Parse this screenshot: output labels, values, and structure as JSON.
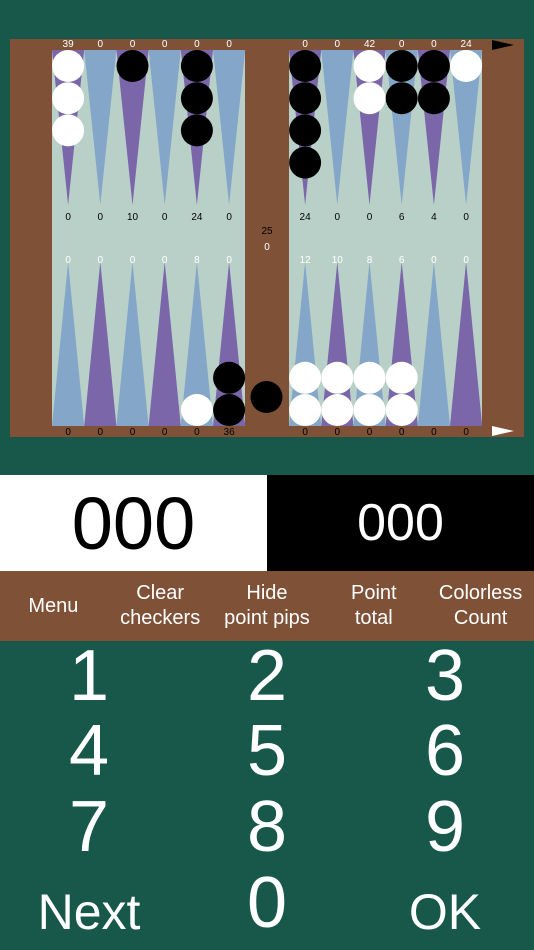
{
  "colors": {
    "background": "#17584a",
    "board_frame": "#7f5238",
    "board_field": "#b9d0c8",
    "point_blue": "#84a6c8",
    "point_purple": "#7a66a8",
    "checker_white": "#ffffff",
    "checker_black": "#000000"
  },
  "board": {
    "top_counts_left": [
      "39",
      "0",
      "0",
      "0",
      "0",
      "0"
    ],
    "top_counts_right": [
      "0",
      "0",
      "42",
      "0",
      "0",
      "24"
    ],
    "top_pips_left": [
      "0",
      "0",
      "10",
      "0",
      "24",
      "0"
    ],
    "top_pips_right": [
      "24",
      "0",
      "0",
      "6",
      "4",
      "0"
    ],
    "bottom_pips_left": [
      "0",
      "0",
      "0",
      "0",
      "8",
      "0"
    ],
    "bottom_pips_right": [
      "12",
      "10",
      "8",
      "6",
      "0",
      "0"
    ],
    "bottom_counts_left": [
      "0",
      "0",
      "0",
      "0",
      "0",
      "36"
    ],
    "bottom_counts_right": [
      "0",
      "0",
      "0",
      "0",
      "0",
      "0"
    ],
    "bar_top_value": "25",
    "bar_bottom_value": "0",
    "top_checkers_left": [
      {
        "color": "white",
        "count": 3
      },
      {
        "color": "none",
        "count": 0
      },
      {
        "color": "black",
        "count": 1
      },
      {
        "color": "none",
        "count": 0
      },
      {
        "color": "black",
        "count": 3
      },
      {
        "color": "none",
        "count": 0
      }
    ],
    "top_checkers_right": [
      {
        "color": "black",
        "count": 4
      },
      {
        "color": "none",
        "count": 0
      },
      {
        "color": "white",
        "count": 2
      },
      {
        "color": "black",
        "count": 2
      },
      {
        "color": "black",
        "count": 2
      },
      {
        "color": "white",
        "count": 1
      }
    ],
    "bottom_checkers_left": [
      {
        "color": "none",
        "count": 0
      },
      {
        "color": "none",
        "count": 0
      },
      {
        "color": "none",
        "count": 0
      },
      {
        "color": "none",
        "count": 0
      },
      {
        "color": "white",
        "count": 1
      },
      {
        "color": "black",
        "count": 2
      }
    ],
    "bottom_checkers_right": [
      {
        "color": "white",
        "count": 2
      },
      {
        "color": "white",
        "count": 2
      },
      {
        "color": "white",
        "count": 2
      },
      {
        "color": "white",
        "count": 2
      },
      {
        "color": "none",
        "count": 0
      },
      {
        "color": "none",
        "count": 0
      }
    ],
    "bar_checkers": [
      {
        "color": "black",
        "count": 1
      }
    ]
  },
  "scores": {
    "white": "000",
    "black": "000"
  },
  "toolbar": {
    "menu": "Menu",
    "clear_checkers": "Clear\ncheckers",
    "hide_point_pips": "Hide\npoint pips",
    "point_total": "Point\ntotal",
    "colorless_count": "Colorless\nCount"
  },
  "keypad": {
    "k1": "1",
    "k2": "2",
    "k3": "3",
    "k4": "4",
    "k5": "5",
    "k6": "6",
    "k7": "7",
    "k8": "8",
    "k9": "9",
    "next": "Next",
    "k0": "0",
    "ok": "OK"
  }
}
